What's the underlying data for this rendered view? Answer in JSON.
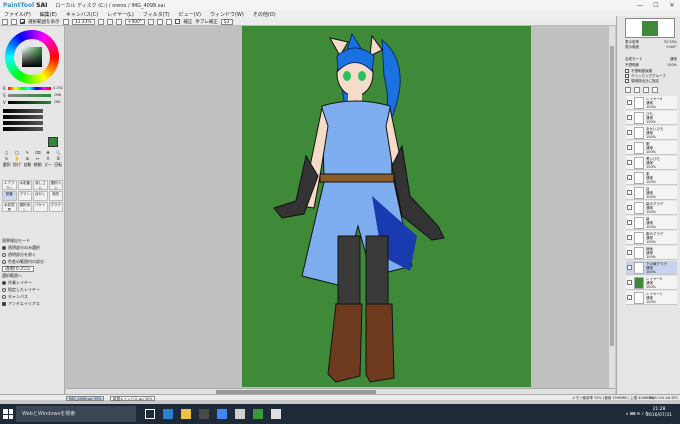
{
  "titlebar": {
    "app_name_a": "PaintTool",
    "app_name_b": "SAI",
    "path": "ローカル ディスク (C:) / oreno / IMG_4098.sai",
    "minimize": "—",
    "maximize": "☐",
    "close": "✕"
  },
  "menu": [
    "ファイル(F)",
    "編集(E)",
    "キャンバス(C)",
    "レイヤー(L)",
    "フィルタ(T)",
    "ビュー(V)",
    "ウィンドウ(W)",
    "その他(O)"
  ],
  "toolbar": {
    "selection_label": "選択範囲を表示",
    "zoom": "33.33%",
    "angle": "+000°",
    "stabilizer_check": "補正",
    "stabilizer_label": "手ブレ補正",
    "stabilizer_value": "S3"
  },
  "left": {
    "sliders": [
      {
        "label": "R",
        "value": "0.292",
        "color": "#d03030"
      },
      {
        "label": "S",
        "value": "098",
        "color": "#40a040"
      },
      {
        "label": "V",
        "value": "061",
        "color": "#404040"
      }
    ],
    "current_color": "#2c8a3a",
    "tools": [
      "◻",
      "◯",
      "✎",
      "⌫",
      "✥",
      "🔍",
      "↻",
      "✋",
      "⊞",
      "↔",
      "A",
      "B"
    ],
    "tool_labels": [
      "選択",
      "投げなわ",
      "自動選択",
      "移動",
      "ズーム",
      "回転"
    ],
    "brushes": [
      "エアブラシ",
      "水彩筆",
      "消しゴム",
      "選択ペン",
      "鉛筆",
      "ブラシ",
      "ぼかし",
      "指先",
      "水彩境界",
      "選択消し",
      "バケツ",
      "グラデ"
    ],
    "options": [
      {
        "label": "境界検出モード",
        "kind": "label",
        "on": false
      },
      {
        "label": "透明部分のみ選択",
        "kind": "radio",
        "on": true
      },
      {
        "label": "透明部分を除く",
        "kind": "radio",
        "on": false
      },
      {
        "label": "色差の範囲内の部分",
        "kind": "radio",
        "on": false
      },
      {
        "label": "透明(0-255)",
        "kind": "label",
        "on": false
      },
      {
        "label": "選択範囲へ",
        "kind": "label",
        "on": false
      },
      {
        "label": "作業レイヤー",
        "kind": "radio",
        "on": true
      },
      {
        "label": "指定したレイヤー",
        "kind": "radio",
        "on": false
      },
      {
        "label": "キャンバス",
        "kind": "radio",
        "on": false
      },
      {
        "label": "アンチエイリアス",
        "kind": "check",
        "on": true
      }
    ]
  },
  "right": {
    "nav_rows": [
      {
        "label": "表示倍率",
        "value": "33.33%"
      },
      {
        "label": "表示角度",
        "value": "+000°"
      }
    ],
    "blend_label": "合成モード",
    "blend_value": "通常",
    "opacity_label": "不透明度",
    "opacity_value": "100%",
    "checks": [
      "不透明度保護",
      "クリッピンググループ",
      "領域検出元に指定"
    ],
    "layers": [
      {
        "name": "レイヤー4",
        "mode": "通常",
        "opacity": "100%",
        "green": false,
        "sel": false
      },
      {
        "name": "ひも",
        "mode": "通常",
        "opacity": "100%",
        "green": false,
        "sel": false
      },
      {
        "name": "あかいひも",
        "mode": "通常",
        "opacity": "100%",
        "green": false,
        "sel": false
      },
      {
        "name": "服",
        "mode": "通常",
        "opacity": "100%",
        "green": false,
        "sel": false
      },
      {
        "name": "黒いひも",
        "mode": "通常",
        "opacity": "100%",
        "green": false,
        "sel": false
      },
      {
        "name": "肌",
        "mode": "通常",
        "opacity": "100%",
        "green": false,
        "sel": false
      },
      {
        "name": "目",
        "mode": "通常",
        "opacity": "100%",
        "green": false,
        "sel": false
      },
      {
        "name": "髪のグラデ",
        "mode": "通常",
        "opacity": "100%",
        "green": false,
        "sel": false
      },
      {
        "name": "髪",
        "mode": "通常",
        "opacity": "100%",
        "green": false,
        "sel": false
      },
      {
        "name": "服のグラデ",
        "mode": "通常",
        "opacity": "100%",
        "green": false,
        "sel": false
      },
      {
        "name": "線画",
        "mode": "通常",
        "opacity": "100%",
        "green": false,
        "sel": false
      },
      {
        "name": "下の線グラデ",
        "mode": "通常",
        "opacity": "100%",
        "green": false,
        "sel": true
      },
      {
        "name": "レイヤー5",
        "mode": "通常",
        "opacity": "100%",
        "green": true,
        "sel": false
      },
      {
        "name": "レイヤー1",
        "mode": "通常",
        "opacity": "100%",
        "green": false,
        "sel": false
      }
    ]
  },
  "status": {
    "tab1": "IMG_4098.sai",
    "tab1_zoom": "33%",
    "tab2": "新規キャンバス.sai",
    "tab2_zoom": "50%",
    "memory": "メモリ使用率 33% (使用 1599MB / 上限 4096MB)",
    "keys": "Shift Ctrl Alt SPC"
  },
  "taskbar": {
    "search": "WebとWindowsを検索",
    "time": "21:28",
    "date": "2016/07/31",
    "tray": "∧ ⌨ ✉ ♪ A"
  },
  "colors": {
    "canvas_bg": "#3f8a39",
    "hair": "#1a72e0",
    "outfit": "#7faef0"
  }
}
